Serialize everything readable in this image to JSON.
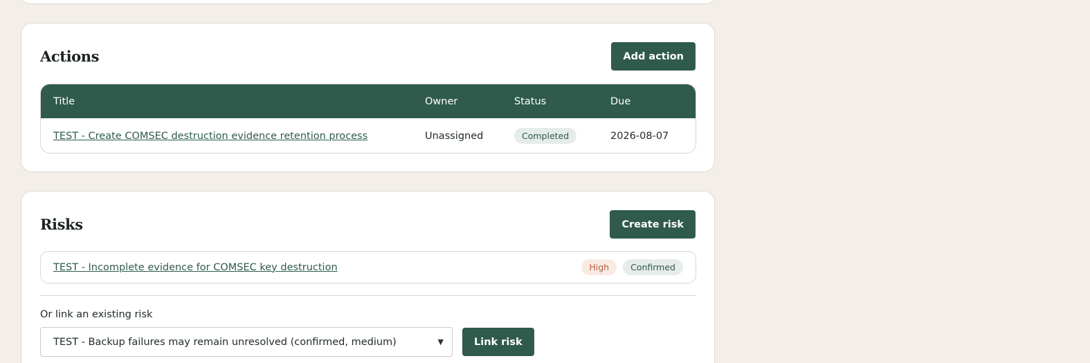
{
  "actions": {
    "title": "Actions",
    "add_button": "Add action",
    "columns": [
      "Title",
      "Owner",
      "Status",
      "Due"
    ],
    "rows": [
      {
        "title": "TEST - Create COMSEC destruction evidence retention process",
        "owner": "Unassigned",
        "status": "Completed",
        "due": "2026-08-07"
      }
    ]
  },
  "risks": {
    "title": "Risks",
    "create_button": "Create risk",
    "items": [
      {
        "title": "TEST - Incomplete evidence for COMSEC key destruction",
        "severity": "High",
        "state": "Confirmed"
      }
    ],
    "link_label": "Or link an existing risk",
    "link_select_value": "TEST - Backup failures may remain unresolved (confirmed, medium)",
    "link_button": "Link risk"
  },
  "colors": {
    "background": "#f3efe8",
    "accent": "#2f5a4c",
    "high_badge_text": "#b85b3d"
  },
  "icons": {
    "select_arrow": "chevron-down-icon"
  }
}
